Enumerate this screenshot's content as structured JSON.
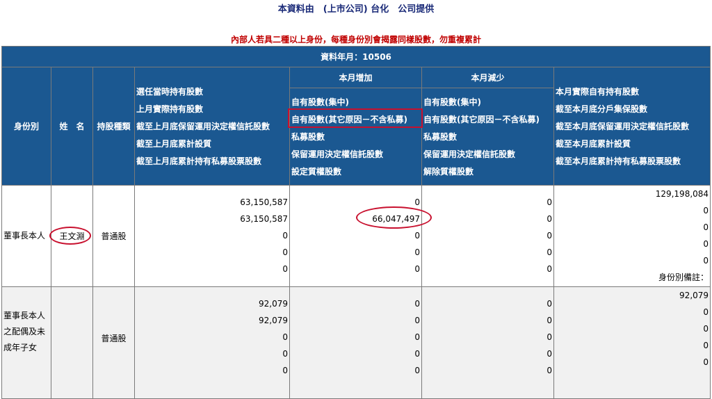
{
  "header": {
    "title": "本資料由　(上市公司) 台化　公司提供",
    "warning": "內部人若具二種以上身份，每種身份別會揭露同樣股數，勿重複累計"
  },
  "table": {
    "year_month": "資料年月：10506",
    "group_headers": {
      "increase": "本月增加",
      "decrease": "本月減少"
    },
    "columns": {
      "identity": "身份別",
      "name": "姓　名",
      "stock_type": "持股種類",
      "holdings": [
        "選任當時持有股數",
        "上月實際持有股數",
        "截至上月底保留運用決定權信託股數",
        "截至上月底累計設質",
        "截至上月底累計持有私募股票股數"
      ],
      "increase": [
        "自有股數(集中)",
        "自有股數(其它原因－不含私募)",
        "私募股數",
        "保留運用決定權信託股數",
        "設定質權股數"
      ],
      "decrease": [
        "自有股數(集中)",
        "自有股數(其它原因－不含私募)",
        "私募股數",
        "保留運用決定權信託股數",
        "解除質權股數"
      ],
      "actual": [
        "本月實際自有持有股數",
        "截至本月底分戶集保股數",
        "截至本月底保留運用決定權信託股數",
        "截至本月底累計設質",
        "截至本月底累計持有私募股票股數"
      ]
    },
    "rows": [
      {
        "identity": "董事長本人",
        "name": "王文淵",
        "stock_type": "普通股",
        "holdings": [
          "63,150,587",
          "63,150,587",
          "0",
          "0",
          "0"
        ],
        "increase": [
          "0",
          "66,047,497",
          "0",
          "0",
          "0"
        ],
        "decrease": [
          "0",
          "0",
          "0",
          "0",
          "0"
        ],
        "actual": [
          "129,198,084",
          "0",
          "0",
          "0",
          "0"
        ],
        "note": "身份別備註："
      },
      {
        "identity": "董事長本人之配偶及未成年子女",
        "name": "",
        "stock_type": "普通股",
        "holdings": [
          "92,079",
          "92,079",
          "0",
          "0",
          "0"
        ],
        "increase": [
          "0",
          "0",
          "0",
          "0",
          "0"
        ],
        "decrease": [
          "0",
          "0",
          "0",
          "0",
          "0"
        ],
        "actual": [
          "92,079",
          "0",
          "0",
          "0",
          "0"
        ]
      }
    ]
  },
  "colors": {
    "header_bg": "#1b5891",
    "title": "#1a2a78",
    "warning": "#c00000",
    "annotation": "#c8102e"
  }
}
